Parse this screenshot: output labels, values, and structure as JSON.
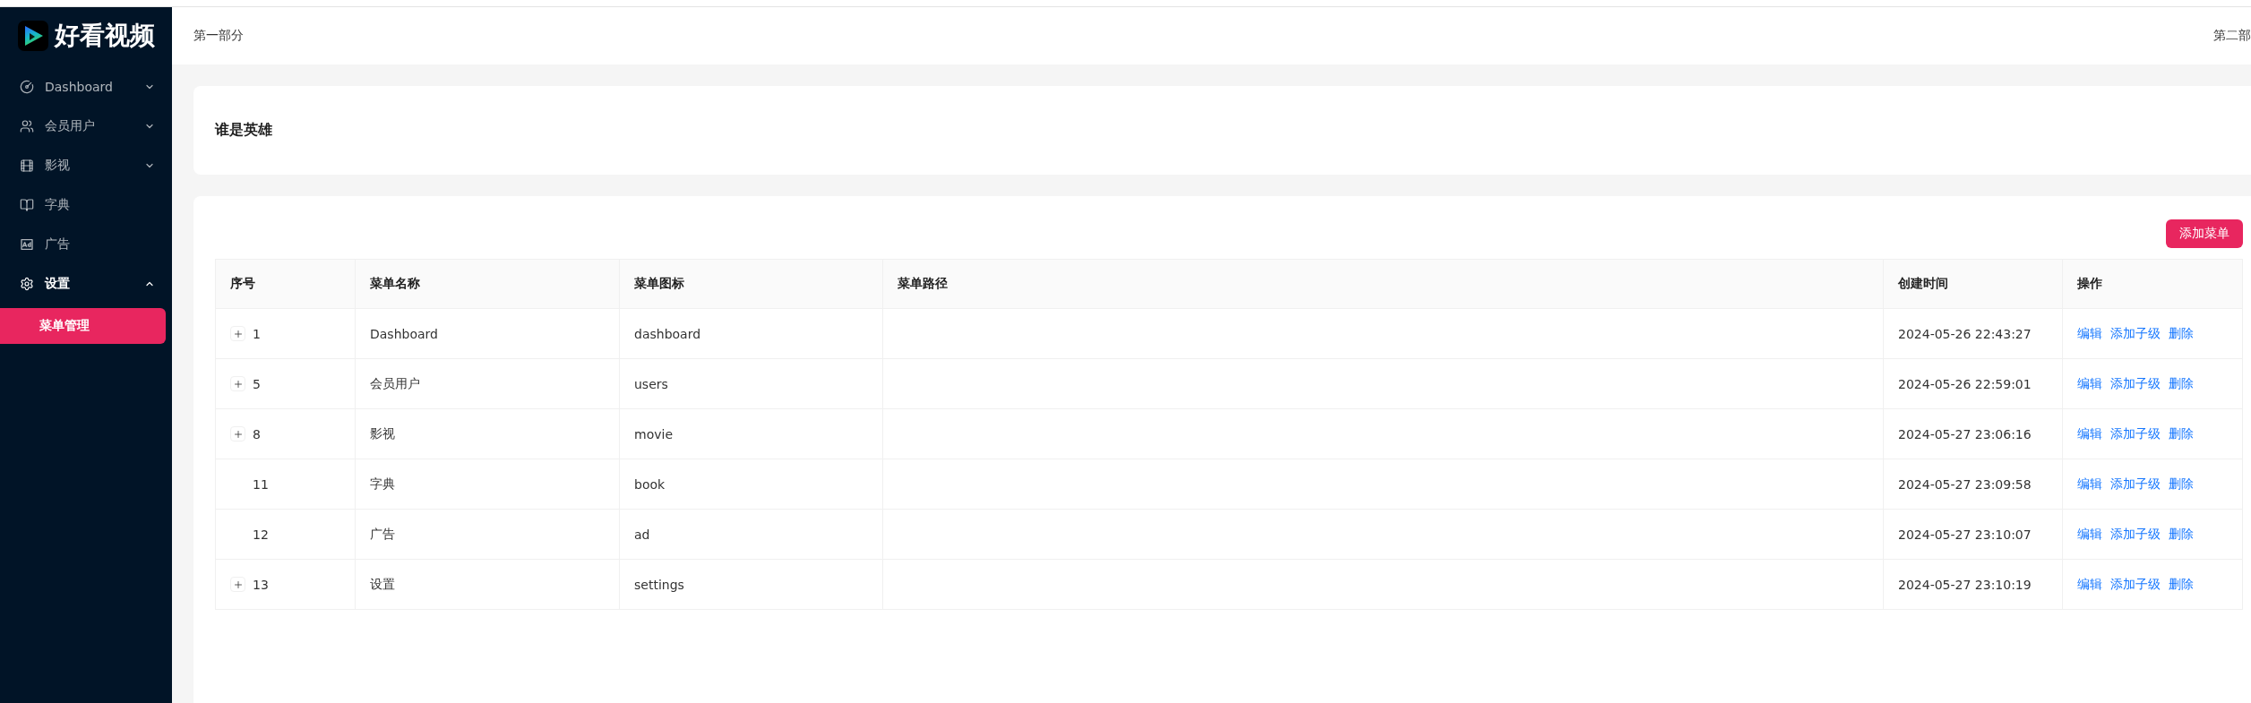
{
  "sidebar": {
    "logo": {
      "text": "好看视频"
    },
    "items": [
      {
        "label": "Dashboard",
        "kind": "submenu",
        "expanded": false,
        "selected": false
      },
      {
        "label": "会员用户",
        "kind": "submenu",
        "expanded": false,
        "selected": false
      },
      {
        "label": "影视",
        "kind": "submenu",
        "expanded": false,
        "selected": false
      },
      {
        "label": "字典",
        "kind": "link",
        "selected": false
      },
      {
        "label": "广告",
        "kind": "link",
        "selected": false
      },
      {
        "label": "设置",
        "kind": "submenu",
        "expanded": true,
        "selected": false,
        "children": [
          {
            "label": "菜单管理",
            "selected": true
          }
        ]
      }
    ]
  },
  "header": {
    "left": "第一部分",
    "right": "第二部"
  },
  "banner": {
    "title": "谁是英雄"
  },
  "menu_panel": {
    "add_button": "添加菜单",
    "table": {
      "columns": [
        "序号",
        "菜单名称",
        "菜单图标",
        "菜单路径",
        "创建时间",
        "操作"
      ],
      "rows": [
        {
          "id": "1",
          "expandable": true,
          "name": "Dashboard",
          "icon": "dashboard",
          "created": "2024-05-26 22:43:27",
          "actions": [
            "编辑",
            "添加子级",
            "删除"
          ]
        },
        {
          "id": "5",
          "expandable": true,
          "name": "会员用户",
          "icon": "users",
          "created": "2024-05-26 22:59:01",
          "actions": [
            "编辑",
            "添加子级",
            "删除"
          ]
        },
        {
          "id": "8",
          "expandable": true,
          "name": "影视",
          "icon": "movie",
          "created": "2024-05-27 23:06:16",
          "actions": [
            "编辑",
            "添加子级",
            "删除"
          ]
        },
        {
          "id": "11",
          "expandable": false,
          "name": "字典",
          "icon": "book",
          "created": "2024-05-27 23:09:58",
          "actions": [
            "编辑",
            "添加子级",
            "删除"
          ]
        },
        {
          "id": "12",
          "expandable": false,
          "name": "广告",
          "icon": "ad",
          "created": "2024-05-27 23:10:07",
          "actions": [
            "编辑",
            "添加子级",
            "删除"
          ]
        },
        {
          "id": "13",
          "expandable": true,
          "name": "设置",
          "icon": "settings",
          "created": "2024-05-27 23:10:19",
          "actions": [
            "编辑",
            "添加子级",
            "删除"
          ]
        }
      ]
    }
  }
}
